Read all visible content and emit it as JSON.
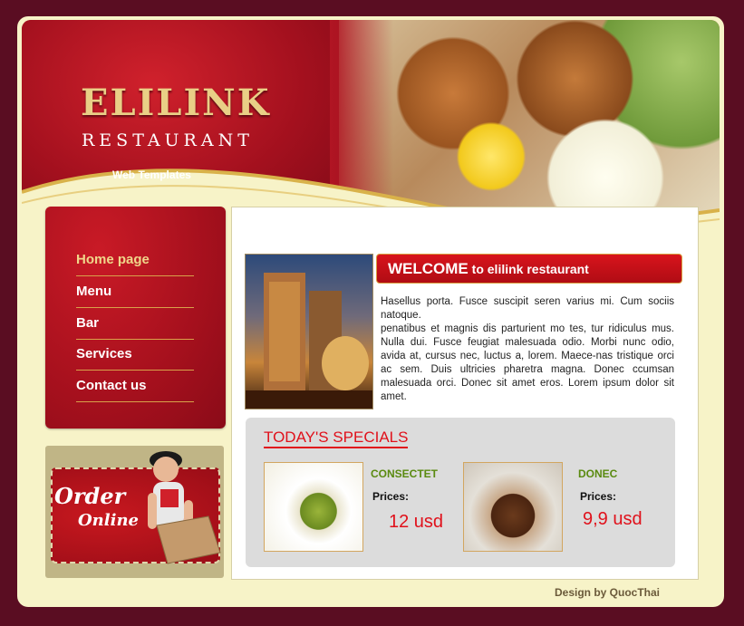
{
  "header": {
    "logo_title": "ELILINK",
    "logo_subtitle": "RESTAURANT",
    "tagline": "Web Templates"
  },
  "nav": {
    "items": [
      {
        "label": "Home page",
        "active": true
      },
      {
        "label": "Menu",
        "active": false
      },
      {
        "label": "Bar",
        "active": false
      },
      {
        "label": "Services",
        "active": false
      },
      {
        "label": "Contact us",
        "active": false
      }
    ]
  },
  "order": {
    "line1": "Order",
    "line2": "Online"
  },
  "welcome": {
    "title_big": "WELCOME",
    "title_small": " to elilink restaurant",
    "paragraph_1": "Hasellus porta. Fusce suscipit seren varius mi. Cum sociis natoque.",
    "paragraph_2": "penatibus et magnis dis parturient mo tes, tur ridiculus mus. Nulla dui. Fusce feugiat malesuada odio. Morbi nunc odio, avida at, cursus nec, luctus a, lorem. Maece-nas tristique orci ac sem. Duis ultricies pharetra magna. Donec ccumsan malesuada orci. Donec sit amet eros. Lorem ipsum dolor sit amet."
  },
  "specials": {
    "title": "TODAY'S SPECIALS",
    "items": [
      {
        "name": "CONSECTET",
        "price_label": "Prices:",
        "price": "12 usd"
      },
      {
        "name": "DONEC",
        "price_label": "Prices:",
        "price": "9,9 usd"
      }
    ]
  },
  "footer": {
    "credit": "Design by QuocThai"
  },
  "colors": {
    "background": "#5a0d22",
    "frame": "#f7f3c8",
    "brand_red": "#b01523",
    "gold": "#e9cf86",
    "price_red": "#e0111b",
    "dish_green": "#5a8a10"
  }
}
